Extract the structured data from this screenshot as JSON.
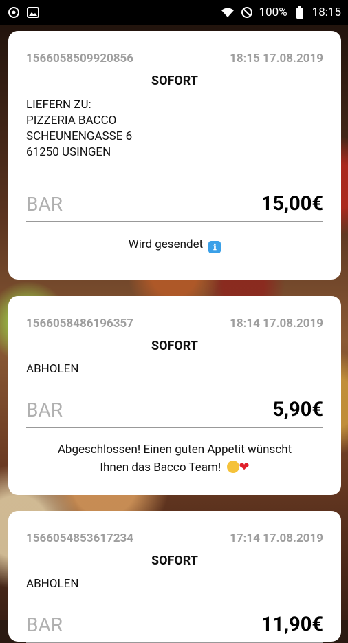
{
  "status_bar": {
    "battery_percent": "100%",
    "time": "18:15",
    "icons": [
      "sync-icon",
      "image-icon",
      "wifi-icon",
      "dnd-icon",
      "battery-icon"
    ]
  },
  "orders": [
    {
      "id": "1566058509920856",
      "datetime": "18:15 17.08.2019",
      "mode": "SOFORT",
      "address": {
        "line1": "LIEFERN ZU:",
        "line2": "PIZZERIA BACCO",
        "line3": "SCHEUNENGASSE 6",
        "line4": "61250 USINGEN"
      },
      "payment": "BAR",
      "amount": "15,00€",
      "status": "Wird gesendet"
    },
    {
      "id": "1566058486196357",
      "datetime": "18:14 17.08.2019",
      "mode": "SOFORT",
      "pickup": "ABHOLEN",
      "payment": "BAR",
      "amount": "5,90€",
      "status_line1": "Abgeschlossen! Einen guten Appetit wünscht",
      "status_line2": "Ihnen das Bacco Team!"
    },
    {
      "id": "1566054853617234",
      "datetime": "17:14 17.08.2019",
      "mode": "SOFORT",
      "pickup": "ABHOLEN",
      "payment": "BAR",
      "amount": "11,90€"
    }
  ]
}
